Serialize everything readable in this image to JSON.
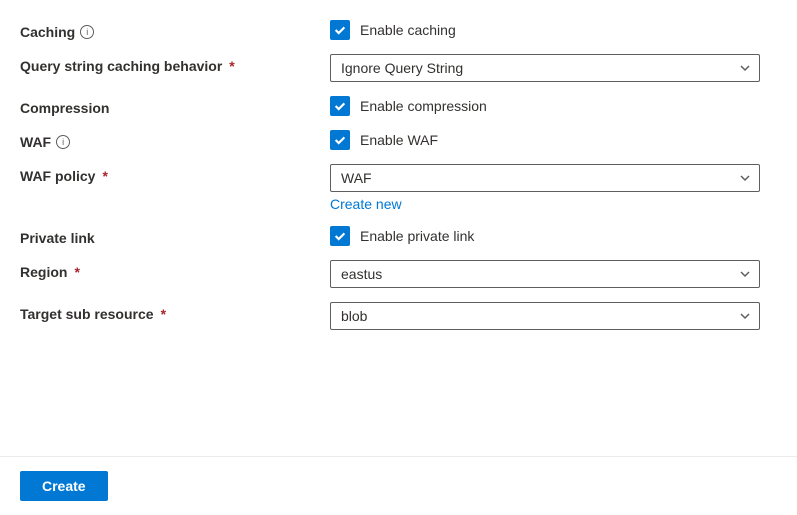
{
  "fields": {
    "caching": {
      "label": "Caching",
      "checkbox_label": "Enable caching",
      "checked": true,
      "has_info": true
    },
    "query_string": {
      "label": "Query string caching behavior",
      "required": true,
      "value": "Ignore Query String"
    },
    "compression": {
      "label": "Compression",
      "checkbox_label": "Enable compression",
      "checked": true
    },
    "waf": {
      "label": "WAF",
      "checkbox_label": "Enable WAF",
      "checked": true,
      "has_info": true
    },
    "waf_policy": {
      "label": "WAF policy",
      "required": true,
      "value": "WAF",
      "create_new_label": "Create new"
    },
    "private_link": {
      "label": "Private link",
      "checkbox_label": "Enable private link",
      "checked": true
    },
    "region": {
      "label": "Region",
      "required": true,
      "value": "eastus"
    },
    "target_sub_resource": {
      "label": "Target sub resource",
      "required": true,
      "value": "blob"
    }
  },
  "footer": {
    "create_label": "Create"
  },
  "required_marker": "*"
}
